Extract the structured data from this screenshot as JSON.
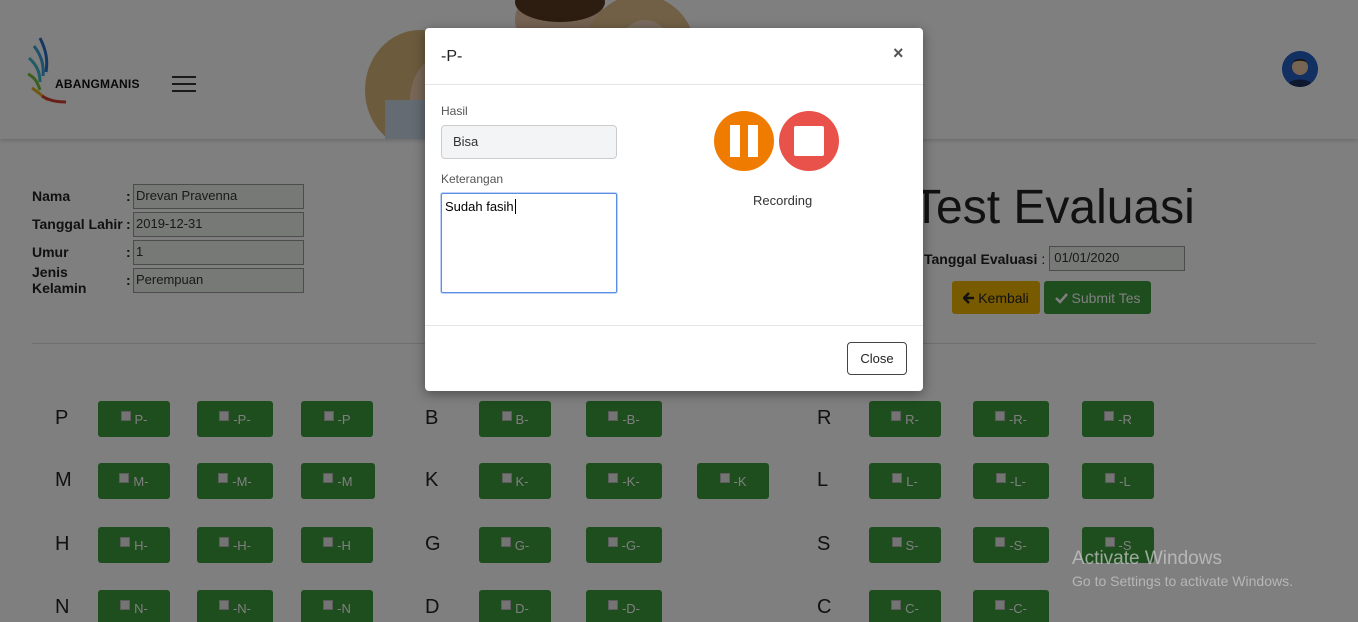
{
  "header": {
    "logo_text": "ABANGMANIS"
  },
  "profile": [
    {
      "label": "Nama",
      "value": "Drevan Pravenna"
    },
    {
      "label": "Tanggal Lahir",
      "value": "2019-12-31"
    },
    {
      "label": "Umur",
      "value": "1"
    },
    {
      "label": "Jenis Kelamin",
      "value": "Perempuan"
    }
  ],
  "profile_colon": ":",
  "page_title": "Test Evaluasi",
  "eval_date": {
    "label": "Tanggal Evaluasi",
    "colon": ":",
    "value": "01/01/2020"
  },
  "buttons": {
    "back": "Kembali",
    "submit": "Submit Tes",
    "back_icon": "arrow-left-icon",
    "submit_icon": "check-icon"
  },
  "grid": {
    "col1": [
      {
        "letter": "P",
        "items": [
          "P-",
          "-P-",
          "-P"
        ]
      },
      {
        "letter": "M",
        "items": [
          "M-",
          "-M-",
          "-M"
        ]
      },
      {
        "letter": "H",
        "items": [
          "H-",
          "-H-",
          "-H"
        ]
      },
      {
        "letter": "N",
        "items": [
          "N-",
          "-N-",
          "-N"
        ]
      }
    ],
    "col2": [
      {
        "letter": "B",
        "items": [
          "B-",
          "-B-"
        ]
      },
      {
        "letter": "K",
        "items": [
          "K-",
          "-K-",
          "-K"
        ]
      },
      {
        "letter": "G",
        "items": [
          "G-",
          "-G-"
        ]
      },
      {
        "letter": "D",
        "items": [
          "D-",
          "-D-"
        ]
      }
    ],
    "col3": [
      {
        "letter": "R",
        "items": [
          "R-",
          "-R-",
          "-R"
        ]
      },
      {
        "letter": "L",
        "items": [
          "L-",
          "-L-",
          "-L"
        ]
      },
      {
        "letter": "S",
        "items": [
          "S-",
          "-S-",
          "-S"
        ]
      },
      {
        "letter": "C",
        "items": [
          "C-",
          "-C-"
        ]
      }
    ]
  },
  "modal": {
    "title": "-P-",
    "close_symbol": "×",
    "hasil_label": "Hasil",
    "hasil_value": "Bisa",
    "keterangan_label": "Keterangan",
    "keterangan_value": "Sudah fasih",
    "recording_label": "Recording",
    "close_button": "Close"
  },
  "watermark": {
    "line1": "Activate Windows",
    "line2": "Go to Settings to activate Windows."
  },
  "colors": {
    "green_button": "#3c9a3c",
    "yellow_button": "#f0b400",
    "pause_orange": "#ef7c00",
    "stop_red": "#e8524a"
  }
}
